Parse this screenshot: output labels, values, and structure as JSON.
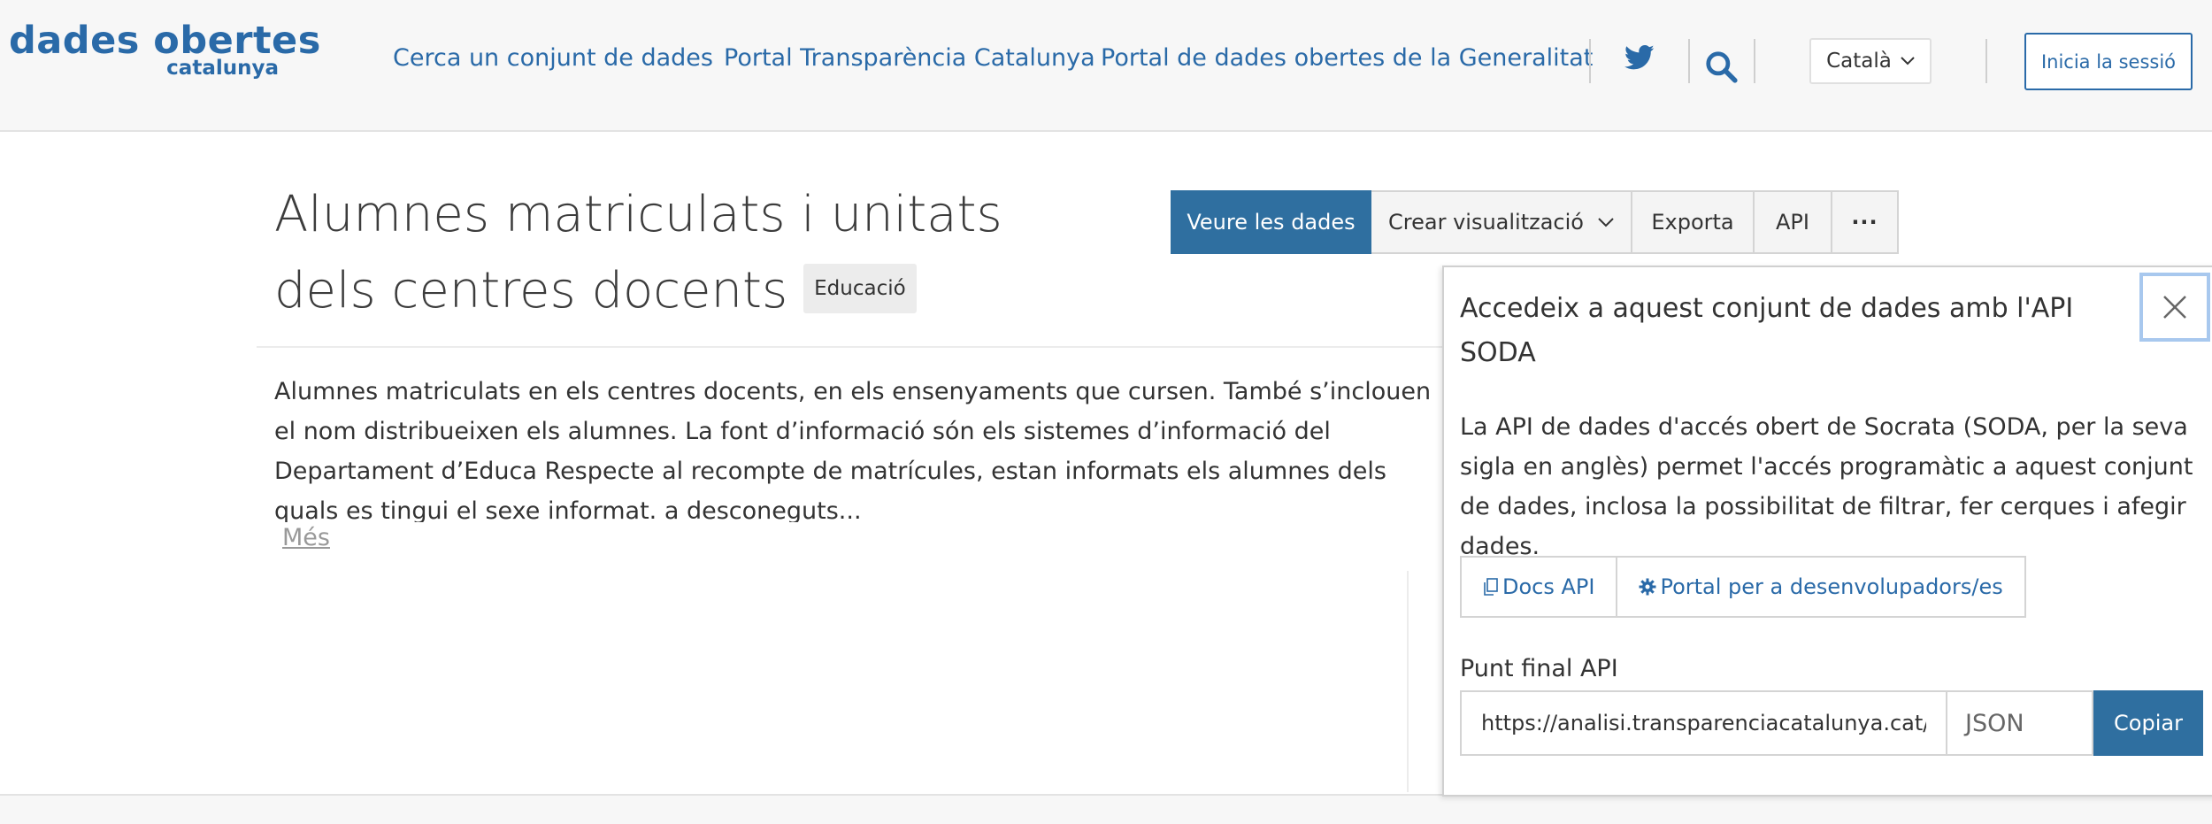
{
  "header": {
    "logo": {
      "title": "dades obertes",
      "subtitle": "catalunya"
    },
    "nav": [
      "Cerca un conjunt de dades",
      "Portal Transparència Catalunya",
      "Portal de dades obertes de la Generalitat"
    ],
    "language": "Català",
    "login_label": "Inicia la sessió",
    "icons": {
      "social": "twitter-icon",
      "search": "search-icon"
    }
  },
  "dataset": {
    "title": "Alumnes matriculats i unitats dels centres docents",
    "category": "Educació",
    "description": "Alumnes matriculats en els centres docents, en els ensenyaments que cursen. També s’inclouen el nom distribueixen els alumnes. La font d’informació són els sistemes d’informació del Departament d’Educa Respecte al recompte de matrícules, estan informats els alumnes dels quals es tingui el sexe informat. a desconeguts...",
    "more_label": "Més"
  },
  "actions": {
    "view_data": "Veure les dades",
    "create_viz": "Crear visualització",
    "export": "Exporta",
    "api": "API",
    "more": "···"
  },
  "api_panel": {
    "title": "Accedeix a aquest conjunt de dades amb l'API SODA",
    "description": "La API de dades d'accés obert de Socrata (SODA, per la seva sigla en anglès) permet l'accés programàtic a aquest conjunt de dades, inclosa la possibilitat de filtrar, fer cerques i afegir dades.",
    "docs_label": "Docs API",
    "dev_portal_label": "Portal per a desenvolupadors/es",
    "endpoint_label": "Punt final API",
    "endpoint_value": "https://analisi.transparenciacatalunya.cat/resource/",
    "format": "JSON",
    "copy_label": "Copiar"
  },
  "colors": {
    "brand": "#2a6aa8",
    "primary_button": "#2f6fa0",
    "header_bg": "#f7f7f7"
  }
}
